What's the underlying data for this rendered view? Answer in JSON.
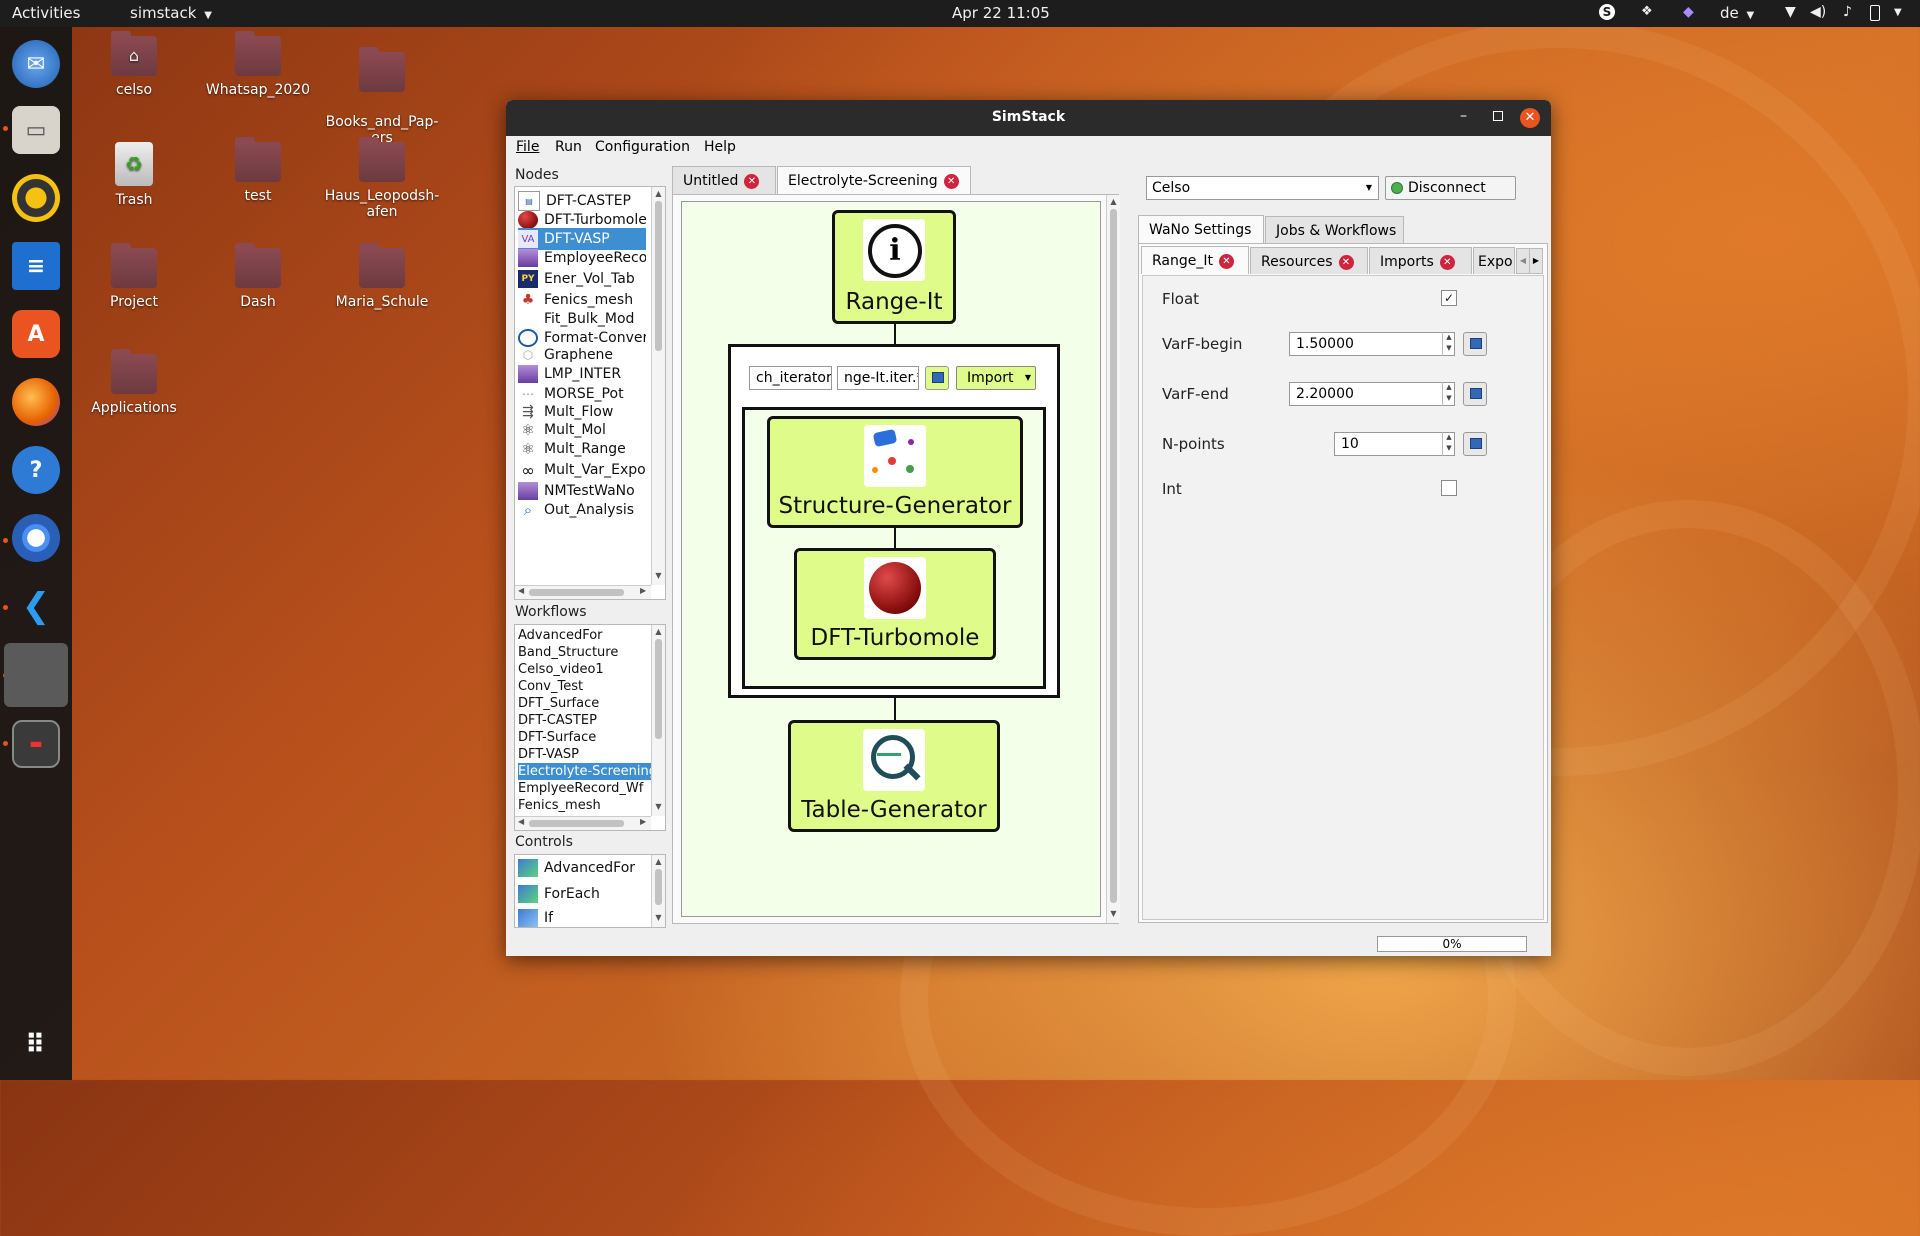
{
  "topbar": {
    "activities": "Activities",
    "app_menu": "simstack",
    "clock": "Apr 22  11:05",
    "keyboard_layout": "de"
  },
  "dock": {
    "items": [
      "thunderbird-icon",
      "files-icon",
      "rhythmbox-icon",
      "libreoffice-writer-icon",
      "software-center-icon",
      "firefox-icon",
      "help-icon",
      "chromium-icon",
      "vscode-icon",
      "simstack-icon",
      "terminal-icon",
      "show-apps-icon"
    ]
  },
  "desktop": {
    "icons": [
      {
        "label": "celso"
      },
      {
        "label": "Whatsap_2020"
      },
      {
        "label": "Books_and_Pap-\ners"
      },
      {
        "label": "Trash"
      },
      {
        "label": "test"
      },
      {
        "label": "Haus_Leopodsh-\nafen"
      },
      {
        "label": "Project"
      },
      {
        "label": "Dash"
      },
      {
        "label": "Maria_Schule"
      },
      {
        "label": "Applications"
      }
    ]
  },
  "window": {
    "title": "SimStack",
    "menu": [
      "File",
      "Run",
      "Configuration",
      "Help"
    ],
    "nodes_label": "Nodes",
    "nodes": [
      {
        "label": "DFT-CASTEP",
        "icon": "castep-icon"
      },
      {
        "label": "DFT-Turbomole",
        "icon": "turbomole-icon"
      },
      {
        "label": "DFT-VASP",
        "icon": "vasp-icon",
        "selected": true
      },
      {
        "label": "EmployeeRecord",
        "icon": "employee-icon"
      },
      {
        "label": "Ener_Vol_Tab",
        "icon": "python-icon"
      },
      {
        "label": "Fenics_mesh",
        "icon": "fenics-icon"
      },
      {
        "label": "Fit_Bulk_Mod",
        "icon": "blank-icon"
      },
      {
        "label": "Format-Converter",
        "icon": "format-icon"
      },
      {
        "label": "Graphene",
        "icon": "graphene-icon"
      },
      {
        "label": "LMP_INTER",
        "icon": "lammps-icon"
      },
      {
        "label": "MORSE_Pot",
        "icon": "morse-icon"
      },
      {
        "label": "Mult_Flow",
        "icon": "flow-icon"
      },
      {
        "label": "Mult_Mol",
        "icon": "atom-icon"
      },
      {
        "label": "Mult_Range",
        "icon": "atom-icon"
      },
      {
        "label": "Mult_Var_Expo",
        "icon": "infinity-icon"
      },
      {
        "label": "NMTestWaNo",
        "icon": "nm-icon"
      },
      {
        "label": "Out_Analysis",
        "icon": "magnifier-icon"
      }
    ],
    "workflows_label": "Workflows",
    "workflows": [
      {
        "label": "AdvancedFor"
      },
      {
        "label": "Band_Structure"
      },
      {
        "label": "Celso_video1"
      },
      {
        "label": "Conv_Test"
      },
      {
        "label": "DFT_Surface"
      },
      {
        "label": "DFT-CASTEP"
      },
      {
        "label": "DFT-Surface"
      },
      {
        "label": "DFT-VASP"
      },
      {
        "label": "Electrolyte-Screening",
        "selected": true
      },
      {
        "label": "EmplyeeRecord_Wf"
      },
      {
        "label": "Fenics_mesh"
      }
    ],
    "controls_label": "Controls",
    "controls": [
      {
        "label": "AdvancedFor"
      },
      {
        "label": "ForEach"
      },
      {
        "label": "If"
      }
    ],
    "tabs": [
      {
        "label": "Untitled"
      },
      {
        "label": "Electrolyte-Screening",
        "active": true
      }
    ],
    "canvas": {
      "top_wano": "Range-It",
      "loop_iterator_field": "ch_iterator",
      "loop_iter_value_field": "nge-It.iter.*",
      "import_button": "Import",
      "inner_wano_1": "Structure-Generator",
      "inner_wano_2": "DFT-Turbomole",
      "bottom_wano": "Table-Generator"
    },
    "right": {
      "server_select": "Celso",
      "disconnect_button": "Disconnect",
      "main_tabs": [
        {
          "label": "WaNo Settings",
          "active": true
        },
        {
          "label": "Jobs & Workflows"
        }
      ],
      "sub_tabs": [
        {
          "label": "Range_It",
          "active": true
        },
        {
          "label": "Resources"
        },
        {
          "label": "Imports"
        },
        {
          "label": "Expo"
        }
      ],
      "settings": {
        "float_label": "Float",
        "float_checked": true,
        "varf_begin_label": "VarF-begin",
        "varf_begin_value": "1.50000",
        "varf_end_label": "VarF-end",
        "varf_end_value": "2.20000",
        "npoints_label": "N-points",
        "npoints_value": "10",
        "int_label": "Int",
        "int_checked": false
      }
    },
    "progress": {
      "text": "0%",
      "value": 0
    }
  }
}
